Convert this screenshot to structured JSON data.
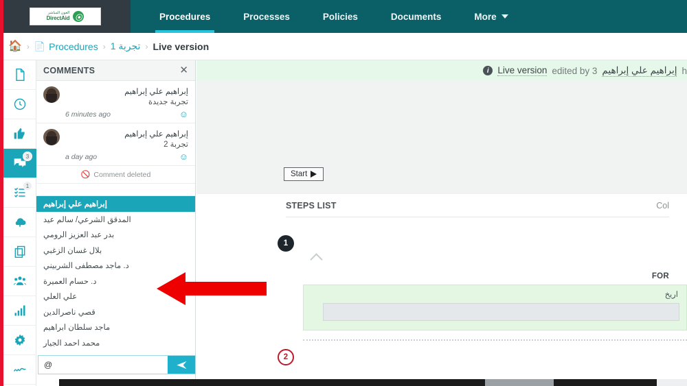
{
  "brand": {
    "logo_arabic": "العون المباشر",
    "logo_english": "DirectAid",
    "logo_mark": "leaf-icon",
    "accent_teal": "#1aa5b8",
    "nav_bg": "#0b5f66",
    "logo_bg": "#323b41",
    "annotation_red": "#e8112d"
  },
  "navbar": {
    "items": [
      {
        "label": "Procedures",
        "active": true
      },
      {
        "label": "Processes",
        "active": false
      },
      {
        "label": "Policies",
        "active": false
      },
      {
        "label": "Documents",
        "active": false
      },
      {
        "label": "More",
        "active": false,
        "has_caret": true
      }
    ]
  },
  "breadcrumb": {
    "home_icon": "home-icon",
    "separator": "›",
    "items": [
      {
        "label": "Procedures",
        "icon": "document-icon",
        "current": false
      },
      {
        "label": "تجربة 1",
        "current": false
      },
      {
        "label": "Live version",
        "current": true
      }
    ]
  },
  "rail": {
    "items": [
      {
        "name": "document-icon",
        "badge": "",
        "active": false
      },
      {
        "name": "history-clock-icon",
        "badge": "",
        "active": false
      },
      {
        "name": "thumbs-up-icon",
        "badge": "",
        "active": false
      },
      {
        "name": "comments-icon",
        "badge": "3",
        "active": true
      },
      {
        "name": "checklist-icon",
        "badge": "1",
        "active": false
      },
      {
        "name": "upload-cloud-icon",
        "badge": "",
        "active": false
      },
      {
        "name": "copy-icon",
        "badge": "",
        "active": false
      },
      {
        "name": "users-group-icon",
        "badge": "",
        "active": false
      },
      {
        "name": "bar-chart-icon",
        "badge": "",
        "active": false
      },
      {
        "name": "gear-icon",
        "badge": "",
        "active": false
      },
      {
        "name": "signature-icon",
        "badge": "",
        "active": false
      }
    ]
  },
  "comments_panel": {
    "title": "COMMENTS",
    "close_label": "✕",
    "comments": [
      {
        "author": "إبراهيم علي إبراهيم",
        "text": "تجربة جديدة",
        "time": "6 minutes ago",
        "reaction_icon": "smiley-icon"
      },
      {
        "author": "إبراهيم علي إبراهيم",
        "text": "تجربة 2",
        "time": "a day ago",
        "reaction_icon": "smiley-icon"
      }
    ],
    "deleted_label": "Comment deleted",
    "deleted_icon": "ban-icon"
  },
  "mentions": {
    "items": [
      {
        "label": "إبراهيم علي إبراهيم",
        "selected": true
      },
      {
        "label": "المدقق الشرعي/ سالم عيد",
        "selected": false
      },
      {
        "label": "بدر عبد العزيز الرومي",
        "selected": false
      },
      {
        "label": "بلال غسان الزغبي",
        "selected": false
      },
      {
        "label": "د. ماجد مصطفى الشربيني",
        "selected": false
      },
      {
        "label": "د. حسام العميرة",
        "selected": false
      },
      {
        "label": "علي العلي",
        "selected": false
      },
      {
        "label": "قصي ناصرالدين",
        "selected": false
      },
      {
        "label": "ماجد سلطان ابراهيم",
        "selected": false
      },
      {
        "label": "محمد احمد الجيار",
        "selected": false
      }
    ]
  },
  "composer": {
    "value": "@",
    "placeholder": "",
    "send_icon": "send-paper-plane-icon"
  },
  "main": {
    "live_banner": {
      "info_icon": "info-icon",
      "strong": "Live version",
      "normal": "edited by 3",
      "user": "إبراهيم علي إبراهيم",
      "truncated": "h"
    },
    "canvas": {
      "start_label": "Start",
      "play_icon": "play-icon"
    },
    "steps": {
      "title": "STEPS LIST",
      "column_header": "Col",
      "rows": [
        {
          "number": "1",
          "style": "dark",
          "collapse_icon": "chevron-up-icon"
        },
        {
          "number": "2",
          "style": "red",
          "collapse_icon": ""
        }
      ],
      "form_label": "FOR",
      "field_label": "اريخ",
      "field_value": ""
    }
  },
  "annotation": {
    "arrow": "left-pointing-arrow",
    "color": "#e8112d"
  }
}
